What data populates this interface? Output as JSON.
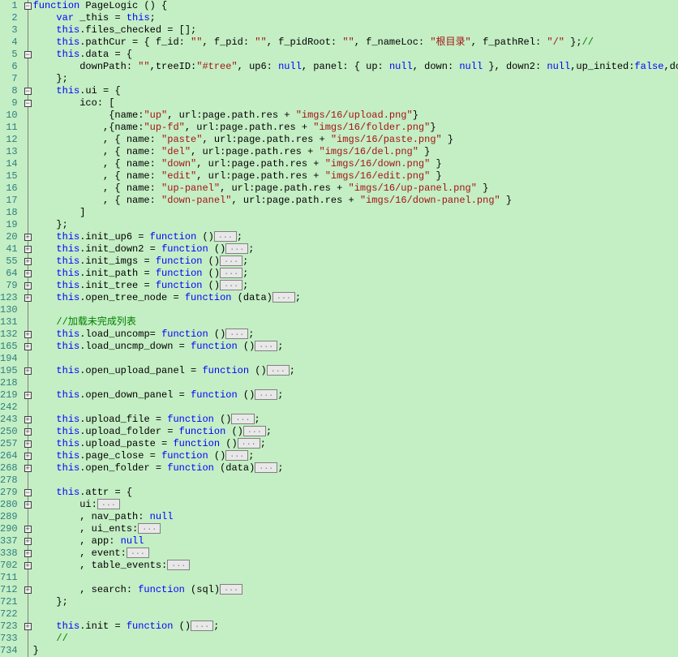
{
  "line_numbers": [
    "1",
    "2",
    "3",
    "4",
    "5",
    "6",
    "7",
    "8",
    "9",
    "10",
    "11",
    "12",
    "13",
    "14",
    "15",
    "16",
    "17",
    "18",
    "19",
    "20",
    "41",
    "55",
    "64",
    "79",
    "123",
    "130",
    "131",
    "132",
    "165",
    "194",
    "195",
    "218",
    "219",
    "242",
    "243",
    "250",
    "257",
    "264",
    "268",
    "278",
    "279",
    "280",
    "289",
    "290",
    "337",
    "338",
    "702",
    "711",
    "712",
    "721",
    "722",
    "723",
    "733",
    "734"
  ],
  "fold_markers": [
    "-",
    "",
    "",
    "",
    "-",
    "",
    "",
    "-",
    "-",
    "",
    "",
    "",
    "",
    "",
    "",
    "",
    "",
    "",
    "",
    "+",
    "+",
    "+",
    "+",
    "+",
    "+",
    "",
    "",
    "+",
    "+",
    "",
    "+",
    "",
    "+",
    "",
    "+",
    "+",
    "+",
    "+",
    "+",
    "",
    "-",
    "+",
    "",
    "+",
    "+",
    "+",
    "+",
    "",
    "+",
    "",
    "",
    "+",
    "",
    ""
  ],
  "tokens": {
    "function": "function",
    "var": "var",
    "this": "this",
    "null": "null",
    "false": "false",
    "PageLogic": "PageLogic",
    "_this": "_this",
    "files_checked": "files_checked",
    "pathCur": "pathCur",
    "f_id": "f_id",
    "f_pid": "f_pid",
    "f_pidRoot": "f_pidRoot",
    "f_nameLoc": "f_nameLoc",
    "root_dir": "\"根目录\"",
    "f_pathRel": "f_pathRel",
    "slash": "\"/\"",
    "data": "data",
    "downPath": "downPath",
    "treeID": "treeID",
    "tree_sel": "\"#tree\"",
    "up6": "up6",
    "panel": "panel",
    "up": "up",
    "down": "down",
    "down2": "down2",
    "up_inited": "up_inited",
    "down_inited": "down_inited",
    "ui": "ui",
    "ico": "ico",
    "name": "name",
    "url": "url",
    "page_path_res": "page.path.res",
    "ico_up": "\"up\"",
    "ico_up_png": "\"imgs/16/upload.png\"",
    "ico_upfd": "\"up-fd\"",
    "ico_folder_png": "\"imgs/16/folder.png\"",
    "ico_paste": "\"paste\"",
    "ico_paste_png": "\"imgs/16/paste.png\"",
    "ico_del": "\"del\"",
    "ico_del_png": "\"imgs/16/del.png\"",
    "ico_down": "\"down\"",
    "ico_down_png": "\"imgs/16/down.png\"",
    "ico_edit": "\"edit\"",
    "ico_edit_png": "\"imgs/16/edit.png\"",
    "ico_up_panel": "\"up-panel\"",
    "ico_up_panel_png": "\"imgs/16/up-panel.png\"",
    "ico_down_panel": "\"down-panel\"",
    "ico_down_panel_png": "\"imgs/16/down-panel.png\"",
    "init_up6": "init_up6",
    "init_down2": "init_down2",
    "init_imgs": "init_imgs",
    "init_path": "init_path",
    "init_tree": "init_tree",
    "open_tree_node": "open_tree_node",
    "comment_load": "//加载未完成列表",
    "load_uncomp": "load_uncomp",
    "load_uncmp_down": "load_uncmp_down",
    "open_upload_panel": "open_upload_panel",
    "open_down_panel": "open_down_panel",
    "upload_file": "upload_file",
    "upload_folder": "upload_folder",
    "upload_paste": "upload_paste",
    "page_close": "page_close",
    "open_folder": "open_folder",
    "attr": "attr",
    "nav_path": "nav_path",
    "ui_ents": "ui_ents",
    "app": "app",
    "event": "event",
    "table_events": "table_events",
    "search": "search",
    "sql": "sql",
    "init": "init",
    "empty_comment": "//",
    "ellipsis": "...",
    "empty_str": "\"\""
  }
}
